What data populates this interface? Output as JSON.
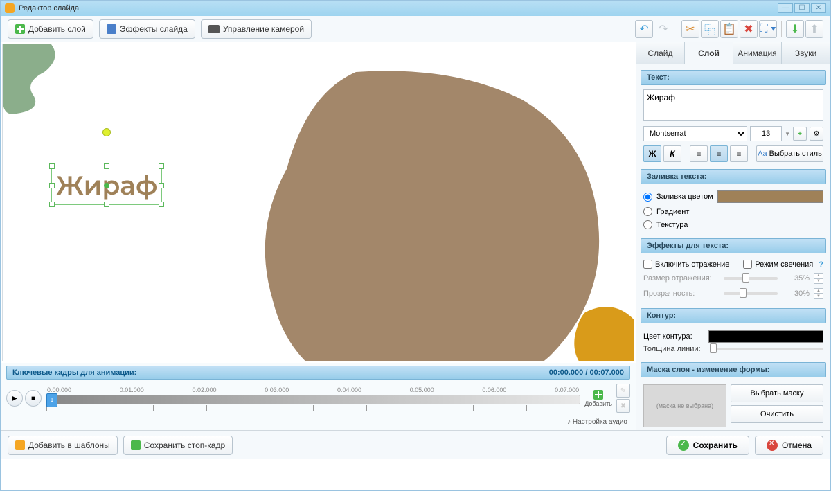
{
  "window": {
    "title": "Редактор слайда"
  },
  "toolbar": {
    "add_layer": "Добавить слой",
    "slide_effects": "Эффекты слайда",
    "camera_control": "Управление камерой"
  },
  "canvas": {
    "text_content": "Жираф"
  },
  "tabs": {
    "slide": "Слайд",
    "layer": "Слой",
    "animation": "Анимация",
    "sounds": "Звуки"
  },
  "panel": {
    "text_header": "Текст:",
    "text_value": "Жираф",
    "font": "Montserrat",
    "font_size": "13",
    "choose_style": "Выбрать стиль",
    "bold": "Ж",
    "italic": "К",
    "fill_header": "Заливка текста:",
    "fill_color": "Заливка цветом",
    "gradient": "Градиент",
    "texture": "Текстура",
    "fill_color_value": "#9f8158",
    "effects_header": "Эффекты для текста:",
    "enable_reflection": "Включить отражение",
    "glow_mode": "Режим свечения",
    "reflection_size": "Размер отражения:",
    "reflection_size_val": "35%",
    "transparency": "Прозрачность:",
    "transparency_val": "30%",
    "contour_header": "Контур:",
    "contour_color": "Цвет контура:",
    "line_width": "Толщина линии:",
    "mask_header": "Маска слоя - изменение формы:",
    "mask_none": "(маска не выбрана)",
    "choose_mask": "Выбрать маску",
    "clear": "Очистить"
  },
  "timeline": {
    "header": "Ключевые кадры для анимации:",
    "time": "00:00.000 / 00:07.000",
    "ticks": [
      "0:00.000",
      "0:01.000",
      "0:02.000",
      "0:03.000",
      "0:04.000",
      "0:05.000",
      "0:06.000",
      "0:07.000"
    ],
    "add": "Добавить",
    "playhead": "1",
    "audio_settings": "Настройка аудио"
  },
  "bottom": {
    "add_templates": "Добавить в шаблоны",
    "save_frame": "Сохранить стоп-кадр",
    "save": "Сохранить",
    "cancel": "Отмена"
  }
}
